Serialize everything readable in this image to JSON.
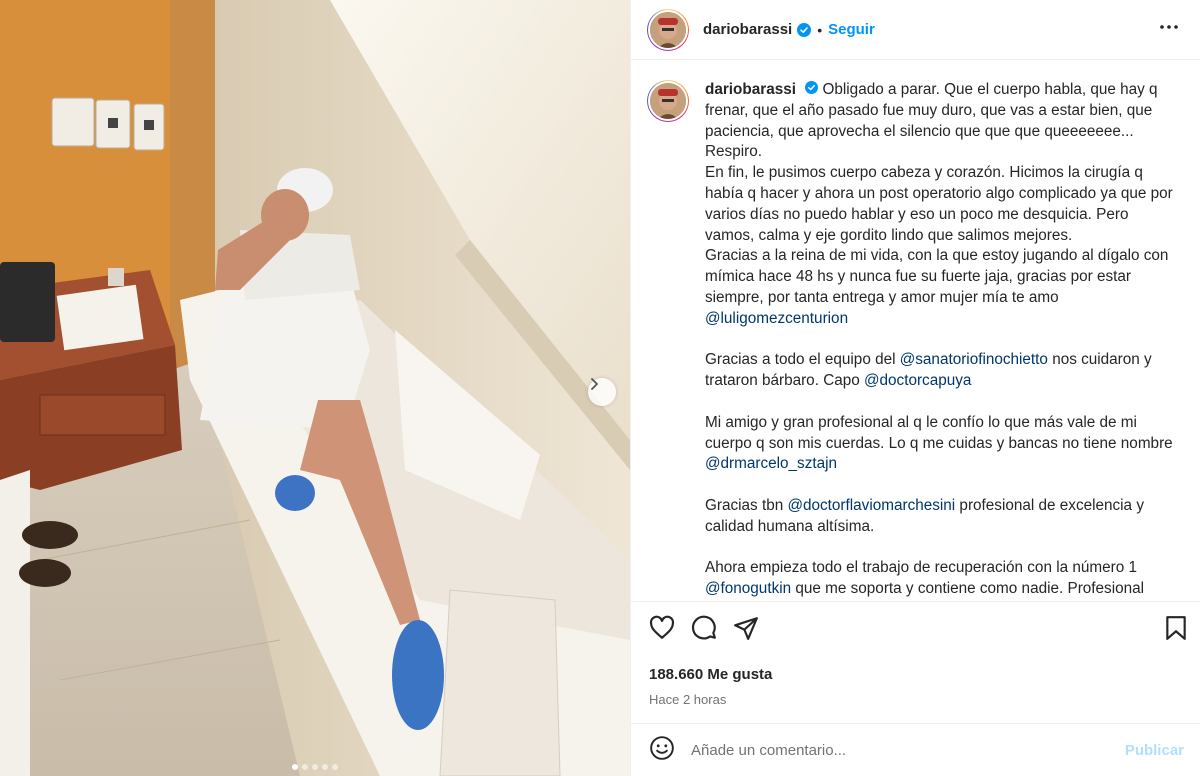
{
  "header": {
    "username": "dariobarassi",
    "separator": "•",
    "follow_label": "Seguir"
  },
  "icons": {
    "verified": "verified-badge-icon",
    "more": "more-options-icon",
    "next": "chevron-right-icon",
    "like": "heart-icon",
    "comment": "comment-icon",
    "share": "share-icon",
    "save": "bookmark-icon",
    "emoji": "emoji-icon"
  },
  "carousel": {
    "count": 5,
    "active_index": 0
  },
  "caption": {
    "username": "dariobarassi",
    "paragraphs": [
      [
        {
          "t": "Obligado a parar. Que el cuerpo habla, que hay q frenar, que el año pasado fue muy duro, que vas a estar bien, que paciencia, que aprovecha el silencio que que que queeeeeee... Respiro."
        }
      ],
      [
        {
          "t": "En fin, le pusimos cuerpo cabeza y corazón. Hicimos la cirugía q había q hacer y ahora un post operatorio algo complicado ya que por varios días no puedo hablar y eso un poco me desquicia. Pero vamos, calma y eje gordito lindo que salimos mejores."
        }
      ],
      [
        {
          "t": "Gracias a la reina de mi vida, con la que estoy jugando al dígalo con mímica hace 48 hs y nunca fue su fuerte jaja, gracias por estar siempre, por tanta entrega y amor mujer mía te amo "
        },
        {
          "t": "@luligomezcenturion",
          "m": true
        }
      ],
      [],
      [
        {
          "t": "Gracias a todo el equipo del "
        },
        {
          "t": "@sanatoriofinochietto",
          "m": true
        },
        {
          "t": " nos cuidaron y trataron bárbaro. Capo "
        },
        {
          "t": "@doctorcapuya",
          "m": true
        }
      ],
      [],
      [
        {
          "t": "Mi amigo y gran profesional al q le confío lo que más vale de mi cuerpo q son mis cuerdas. Lo q me cuidas y bancas no tiene nombre "
        },
        {
          "t": "@drmarcelo_sztajn",
          "m": true
        }
      ],
      [],
      [
        {
          "t": "Gracias tbn "
        },
        {
          "t": "@doctorflaviomarchesini",
          "m": true
        },
        {
          "t": " profesional de excelencia y calidad humana altísima."
        }
      ],
      [],
      [
        {
          "t": "Ahora empieza todo el trabajo de recuperación con la número 1 "
        },
        {
          "t": "@fonogutkin",
          "m": true
        },
        {
          "t": " que me soporta y contiene como nadie. Profesional"
        }
      ]
    ]
  },
  "likes": "188.660 Me gusta",
  "timestamp": "Hace 2 horas",
  "comment": {
    "placeholder": "Añade un comentario...",
    "publish_label": "Publicar"
  },
  "colors": {
    "accent": "#0095f6",
    "mention": "#00376b",
    "publish_disabled": "#b2dffc",
    "muted": "#737373"
  }
}
